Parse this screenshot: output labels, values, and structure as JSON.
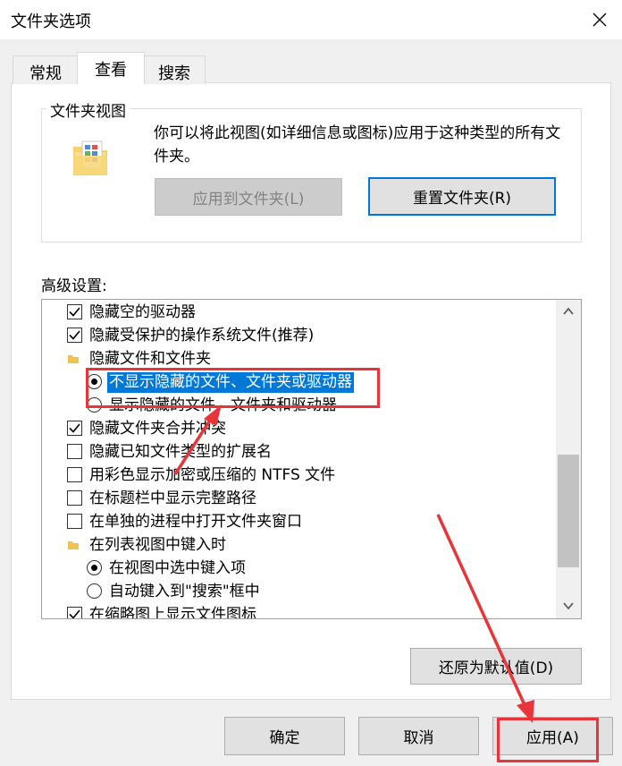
{
  "window": {
    "title": "文件夹选项"
  },
  "tabs": [
    {
      "label": "常规"
    },
    {
      "label": "查看"
    },
    {
      "label": "搜索"
    }
  ],
  "folder_views": {
    "label": "文件夹视图",
    "description": "你可以将此视图(如详细信息或图标)应用于这种类型的所有文件夹。",
    "apply_button": "应用到文件夹(L)",
    "reset_button": "重置文件夹(R)"
  },
  "advanced": {
    "label": "高级设置:",
    "items": [
      {
        "kind": "checkbox",
        "checked": true,
        "label": "隐藏空的驱动器"
      },
      {
        "kind": "checkbox",
        "checked": true,
        "label": "隐藏受保护的操作系统文件(推荐)"
      },
      {
        "kind": "folder",
        "label": "隐藏文件和文件夹"
      },
      {
        "kind": "radio",
        "checked": true,
        "selected": true,
        "label": "不显示隐藏的文件、文件夹或驱动器"
      },
      {
        "kind": "radio",
        "checked": false,
        "label": "显示隐藏的文件、文件夹和驱动器"
      },
      {
        "kind": "checkbox",
        "checked": true,
        "label": "隐藏文件夹合并冲突"
      },
      {
        "kind": "checkbox",
        "checked": false,
        "label": "隐藏已知文件类型的扩展名"
      },
      {
        "kind": "checkbox",
        "checked": false,
        "label": "用彩色显示加密或压缩的 NTFS 文件"
      },
      {
        "kind": "checkbox",
        "checked": false,
        "label": "在标题栏中显示完整路径"
      },
      {
        "kind": "checkbox",
        "checked": false,
        "label": "在单独的进程中打开文件夹窗口"
      },
      {
        "kind": "folder",
        "label": "在列表视图中键入时"
      },
      {
        "kind": "radio",
        "checked": true,
        "label": "在视图中选中键入项"
      },
      {
        "kind": "radio",
        "checked": false,
        "label": "自动键入到\"搜索\"框中"
      },
      {
        "kind": "checkbox",
        "checked": true,
        "label": "在缩略图上显示文件图标"
      }
    ],
    "restore_button": "还原为默认值(D)"
  },
  "footer": {
    "ok_button": "确定",
    "cancel_button": "取消",
    "apply_button": "应用(A)"
  },
  "colors": {
    "selection": "#0078d7",
    "annotation": "#e8343a",
    "focus_border": "#0078d7"
  }
}
